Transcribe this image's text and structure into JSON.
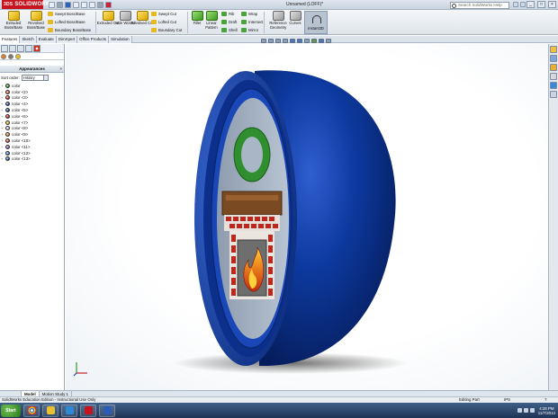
{
  "app": {
    "logo_brand": "3DS",
    "logo_text": "SOLIDWORKS",
    "doc_title": "Unnamed (LOFF)*",
    "search_placeholder": "Search SolidWorks Help",
    "window_controls": [
      "_",
      "□",
      "×"
    ]
  },
  "ribbon": {
    "extruded_boss": "Extruded Boss/Base",
    "revolved_boss": "Revolved Boss/Base",
    "swept_boss": "Swept Boss/Base",
    "lofted_boss": "Lofted Boss/Base",
    "boundary_boss": "Boundary Boss/Base",
    "extruded_cut": "Extruded Cut",
    "hole_wizard": "Hole Wizard",
    "revolved_cut": "Revolved Cut",
    "swept_cut": "Swept Cut",
    "lofted_cut": "Lofted Cut",
    "boundary_cut": "Boundary Cut",
    "fillet": "Fillet",
    "linear_pattern": "Linear Pattern",
    "rib": "Rib",
    "draft": "Draft",
    "shell": "Shell",
    "wrap": "Wrap",
    "intersect": "Intersect",
    "mirror": "Mirror",
    "reference_geometry": "Reference Geometry",
    "curves": "Curves",
    "instant3d": "Instant3D"
  },
  "tabs": [
    "Features",
    "Sketch",
    "Evaluate",
    "DimXpert",
    "Office Products",
    "Simulation"
  ],
  "active_tab": 0,
  "panel": {
    "title": "Appearances",
    "close": "×",
    "sort_label": "Sort order:",
    "sort_value": "History",
    "colors": [
      {
        "name": "color",
        "hex": "#2f9e2f"
      },
      {
        "name": "color <2>",
        "hex": "#e0602a"
      },
      {
        "name": "color <3>",
        "hex": "#d03226"
      },
      {
        "name": "color <4>",
        "hex": "#2a4fbf"
      },
      {
        "name": "color <5>",
        "hex": "#1d3fa8"
      },
      {
        "name": "color <6>",
        "hex": "#c8261c"
      },
      {
        "name": "color <7>",
        "hex": "#e8c020"
      },
      {
        "name": "color <8>",
        "hex": "#d8d8d8"
      },
      {
        "name": "color <9>",
        "hex": "#e68a2a"
      },
      {
        "name": "color <10>",
        "hex": "#d84830"
      },
      {
        "name": "color <11>",
        "hex": "#8a60b8"
      },
      {
        "name": "color <12>",
        "hex": "#3b7ed8"
      },
      {
        "name": "color <13>",
        "hex": "#2462b0"
      }
    ]
  },
  "bottom_tabs": [
    "Model",
    "Motion Study 1"
  ],
  "status": {
    "left": "SolidWorks Education Edition - Instructional Use Only",
    "part": "Editing Part",
    "units": "IPS",
    "help": "?"
  },
  "taskbar": {
    "start": "Start",
    "time": "4:28 PM",
    "date": "11/7/2014"
  },
  "colors": {
    "shell_blue": "#0d3aa0",
    "ring_green": "#2f8f2f",
    "brick_red": "#c2261b"
  }
}
